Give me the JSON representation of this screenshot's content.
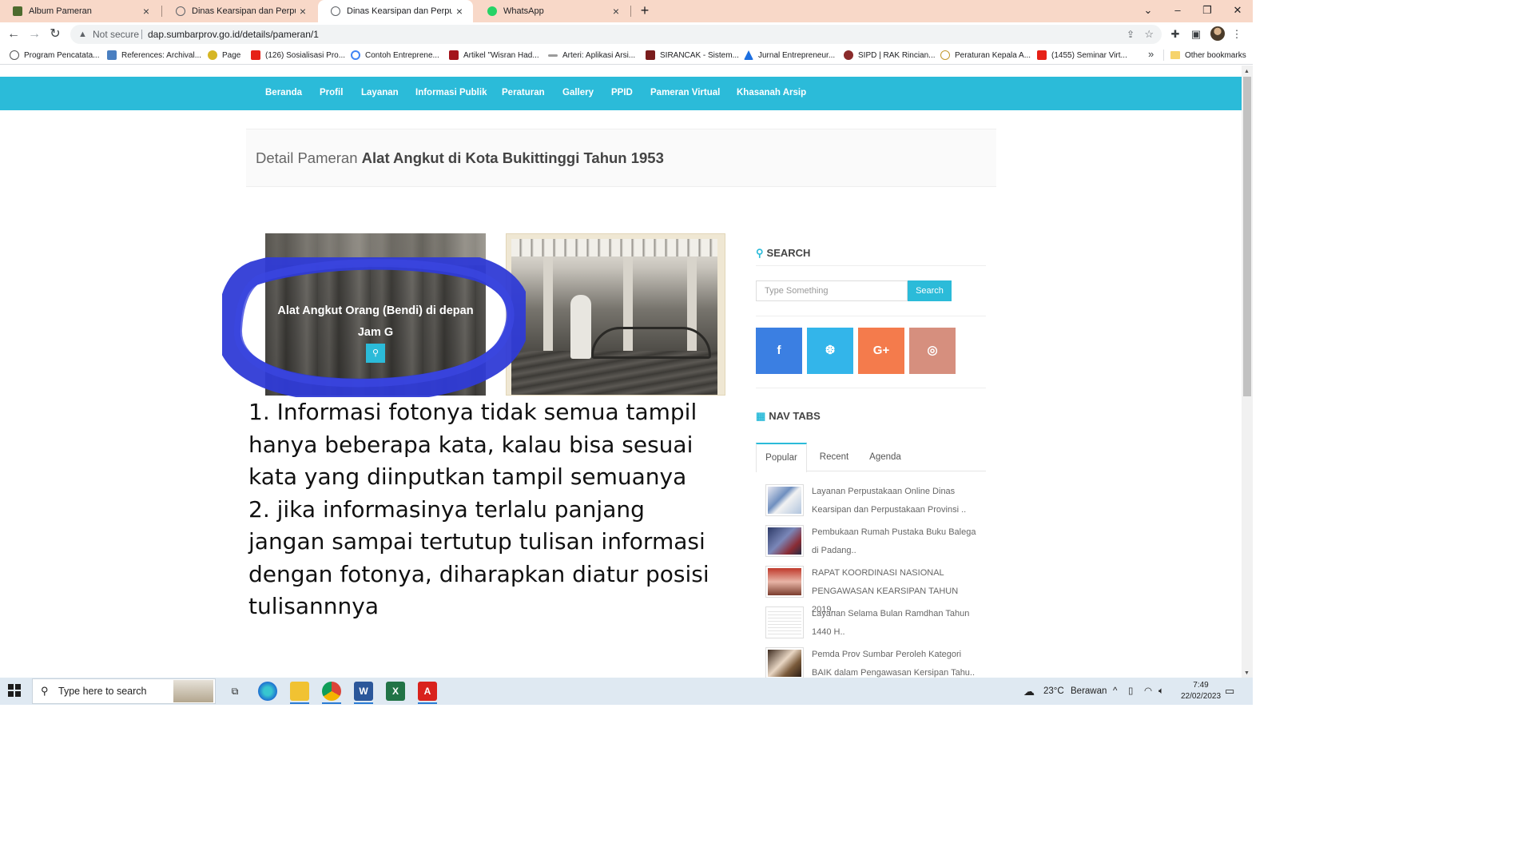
{
  "browser": {
    "tabs": [
      {
        "title": "Album Pameran",
        "active": false
      },
      {
        "title": "Dinas Kearsipan dan Perpustakaan",
        "active": false
      },
      {
        "title": "Dinas Kearsipan dan Perpustakaan",
        "active": true
      },
      {
        "title": "WhatsApp",
        "active": false
      }
    ],
    "security_label": "Not secure",
    "url": "dap.sumbarprov.go.id/details/pameran/1",
    "bookmarks": [
      "Program Pencatata...",
      "References: Archival...",
      "Page",
      "(126) Sosialisasi Pro...",
      "Contoh Entreprene...",
      "Artikel \"Wisran Had...",
      "Arteri: Aplikasi Arsi...",
      "SIRANCAK - Sistem...",
      "Jurnal Entrepreneur...",
      "SIPD | RAK Rincian...",
      "Peraturan Kepala A...",
      "(1455) Seminar Virt..."
    ],
    "other_bookmarks": "Other bookmarks"
  },
  "site_nav": [
    "Beranda",
    "Profil",
    "Layanan",
    "Informasi Publik",
    "Peraturan",
    "Gallery",
    "PPID",
    "Pameran Virtual",
    "Khasanah Arsip"
  ],
  "page_header": {
    "prefix": "Detail Pameran",
    "title": "Alat Angkut di Kota Bukittinggi Tahun 1953"
  },
  "gallery": {
    "photo1_caption": "Alat Angkut Orang (Bendi) di depan Jam G"
  },
  "note_lines": [
    "1. Informasi fotonya tidak semua tampil",
    "hanya beberapa kata, kalau bisa sesuai",
    "kata yang diinputkan tampil semuanya",
    "2. jika informasinya terlalu panjang",
    "jangan sampai tertutup tulisan informasi",
    "dengan fotonya, diharapkan diatur posisi",
    "tulisannnya"
  ],
  "sidebar": {
    "search_title": "SEARCH",
    "search_placeholder": "Type Something",
    "search_button": "Search",
    "social": [
      {
        "icon": "facebook-icon",
        "glyph": "f",
        "color": "#3b7fe2"
      },
      {
        "icon": "twitter-icon",
        "glyph": "t",
        "color": "#33b5ea"
      },
      {
        "icon": "google-plus-icon",
        "glyph": "G+",
        "color": "#f47b4c"
      },
      {
        "icon": "instagram-icon",
        "glyph": "◎",
        "color": "#d68f7e"
      }
    ],
    "navtabs_title": "NAV TABS",
    "tabs": [
      "Popular",
      "Recent",
      "Agenda"
    ],
    "posts": [
      {
        "line1": "Layanan Perpustakaan Online Dinas",
        "line2": "Kearsipan dan Perpustakaan Provinsi .."
      },
      {
        "line1": "Pembukaan Rumah Pustaka Buku Balega",
        "line2": "di Padang.."
      },
      {
        "line1": "RAPAT KOORDINASI NASIONAL",
        "line2": "PENGAWASAN KEARSIPAN TAHUN 2019.."
      },
      {
        "line1": "Layanan Selama Bulan Ramdhan Tahun",
        "line2": "1440 H.."
      },
      {
        "line1": "Pemda Prov Sumbar Peroleh Kategori",
        "line2": "BAIK dalam Pengawasan Kersipan Tahu.."
      }
    ]
  },
  "taskbar": {
    "search_placeholder": "Type here to search",
    "weather_temp": "23°C",
    "weather_text": "Berawan",
    "time": "7:49",
    "date": "22/02/2023"
  }
}
